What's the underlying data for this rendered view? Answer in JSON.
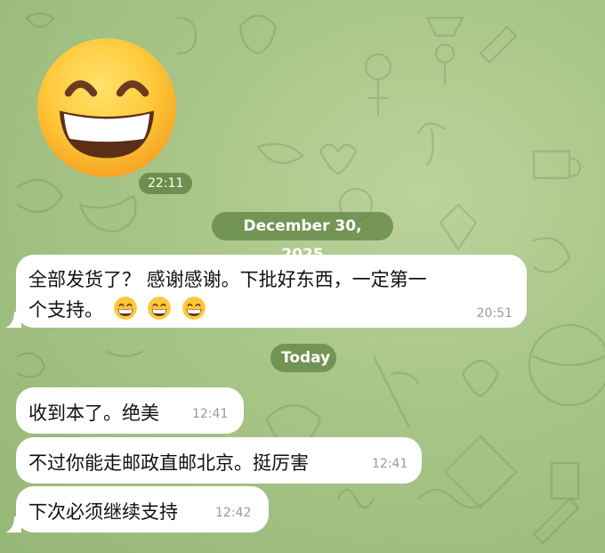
{
  "chat": {
    "sticker_time": "22:11",
    "date_separator_1": "December 30, 2025",
    "message_1": {
      "line1": "全部发货了？ 感谢感谢。下批好东西，一定第一",
      "line2": "个支持。",
      "emoji_count": 3,
      "time": "20:51"
    },
    "date_separator_2": "Today",
    "message_2": {
      "text": "收到本了。绝美",
      "time": "12:41"
    },
    "message_3": {
      "text": "不过你能走邮政直邮北京。挺厉害",
      "time": "12:41"
    },
    "message_4": {
      "text": "下次必须继续支持",
      "time": "12:42"
    }
  },
  "colors": {
    "background": "#a9c689",
    "pill": "#5c803e",
    "bubble": "#ffffff",
    "timestamp": "#9a9a9a"
  }
}
